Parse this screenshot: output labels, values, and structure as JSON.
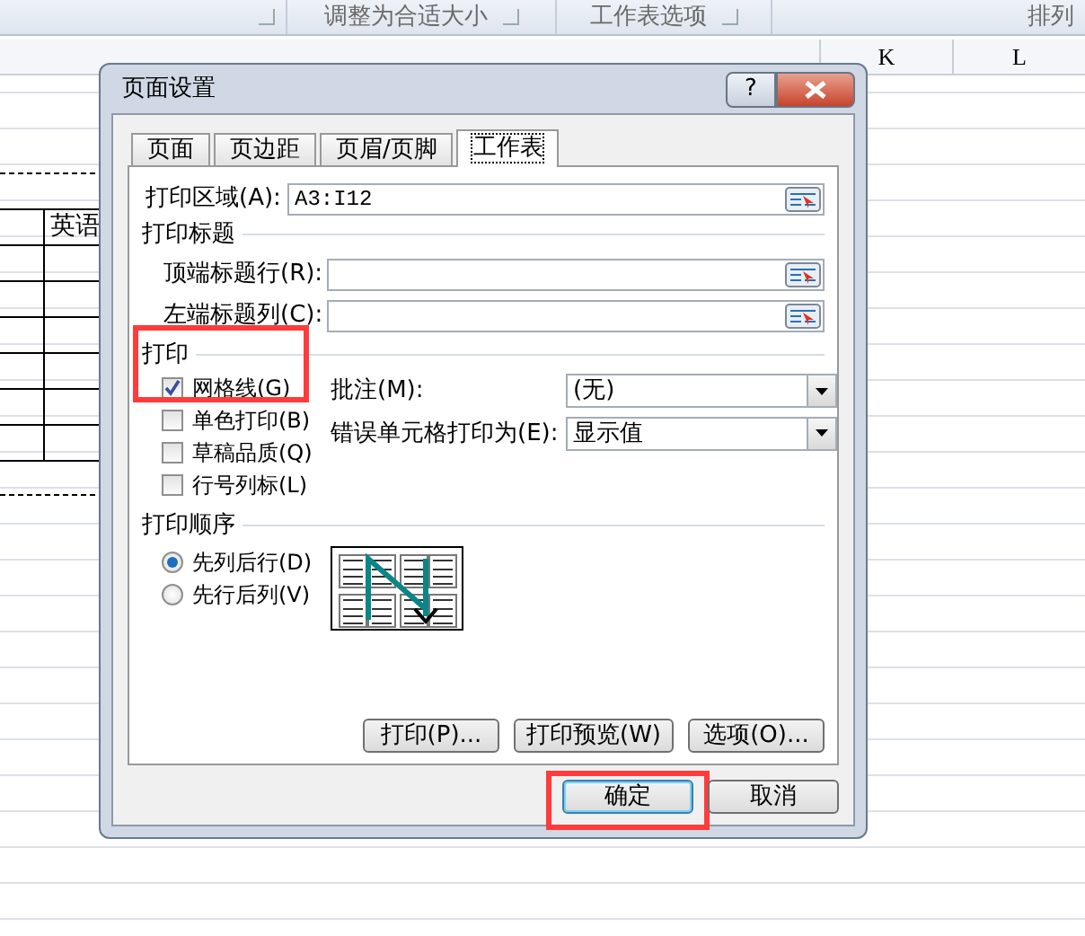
{
  "ribbon": {
    "first_group_launcher": true,
    "groups": [
      {
        "label": "调整为合适大小",
        "launcher": true
      },
      {
        "label": "工作表选项",
        "launcher": true
      },
      {
        "label": "排列"
      }
    ]
  },
  "sheet": {
    "column_headers": [
      "K",
      "L"
    ],
    "cells": [
      "英语"
    ]
  },
  "dialog": {
    "title": "页面设置",
    "help_button": "?",
    "tabs": [
      {
        "label": "页面",
        "selected": false
      },
      {
        "label": "页边距",
        "selected": false
      },
      {
        "label": "页眉/页脚",
        "selected": false
      },
      {
        "label": "工作表",
        "selected": true
      }
    ],
    "print_area": {
      "label": "打印区域(A):",
      "value": "A3:I12"
    },
    "print_titles": {
      "heading": "打印标题",
      "fields": [
        {
          "label": "顶端标题行(R):"
        },
        {
          "label": "左端标题列(C):"
        }
      ]
    },
    "print": {
      "heading": "打印",
      "options": [
        {
          "label": "网格线(G)",
          "checked": true,
          "highlighted": true
        },
        {
          "label": "单色打印(B)",
          "checked": false
        },
        {
          "label": "草稿品质(Q)",
          "checked": false
        },
        {
          "label": "行号列标(L)",
          "checked": false
        }
      ],
      "selects": [
        {
          "label": "批注(M):",
          "value": "(无)"
        },
        {
          "label": "错误单元格打印为(E):",
          "value": "显示值"
        }
      ]
    },
    "page_order": {
      "heading": "打印顺序",
      "options": [
        {
          "label": "先列后行(D)",
          "selected": true
        },
        {
          "label": "先行后列(V)",
          "selected": false
        }
      ]
    },
    "panel_buttons": [
      "打印(P)...",
      "打印预览(W)",
      "选项(O)..."
    ],
    "buttons": [
      {
        "label": "确定",
        "default": true,
        "highlighted": true
      },
      {
        "label": "取消",
        "default": false,
        "highlighted": false
      }
    ]
  }
}
